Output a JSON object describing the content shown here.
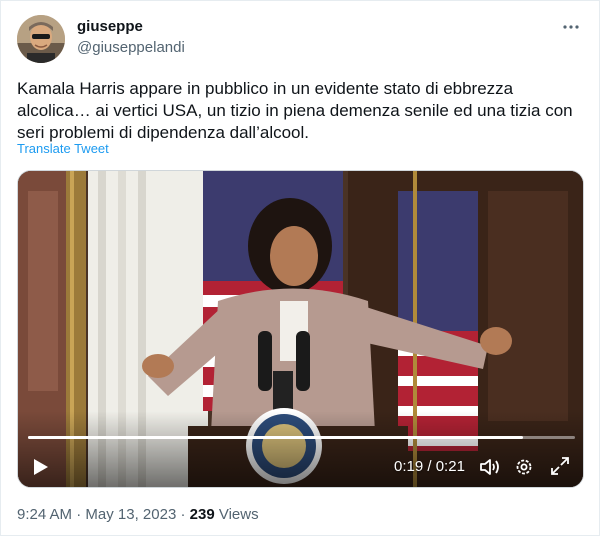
{
  "author": {
    "display_name": "giuseppe",
    "handle": "@giuseppelandi",
    "avatar_icon": "user-avatar"
  },
  "more_icon": "more-dots-icon",
  "tweet": {
    "text": "Kamala Harris appare in pubblico in un evidente stato di ebbrezza\nalcolica… ai vertici USA, un tizio in piena demenza senile ed una tizia con\nseri problemi di dipendenza dall’alcool.",
    "translate_label": "Translate Tweet"
  },
  "video": {
    "current_time": "0:19",
    "separator": " / ",
    "duration": "0:21",
    "progress_fraction": 0.905,
    "controls": {
      "play_icon": "play-icon",
      "volume_icon": "volume-icon",
      "settings_icon": "gear-icon",
      "fullscreen_icon": "expand-icon"
    }
  },
  "meta": {
    "time": "9:24 AM",
    "dot1": " · ",
    "date": "May 13, 2023",
    "dot2": " · ",
    "views_count": "239",
    "views_label": " Views"
  },
  "colors": {
    "link": "#1d9bf0",
    "secondary_text": "#536471",
    "primary_text": "#0f1419"
  }
}
